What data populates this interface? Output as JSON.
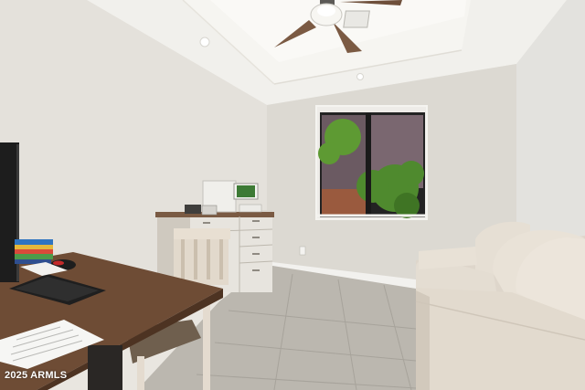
{
  "watermark": {
    "text": "2025 ARMLS"
  },
  "scene_objects": [
    "ceiling-fan",
    "tray-ceiling",
    "window",
    "dresser",
    "desk",
    "keyboard",
    "mouse",
    "monitor",
    "chair",
    "sofa",
    "tile-floor"
  ],
  "colors": {
    "wall_left": "#e5e2dc",
    "wall_back": "#dedbd4",
    "wall_right": "#e4e3df",
    "ceiling": "#f3f2ee",
    "floor": "#b9b5ad",
    "desk_wood": "#6b4a33",
    "sofa": "#e2dbd0",
    "dresser": "#e6e3dd",
    "foliage": "#4f8a2e"
  }
}
